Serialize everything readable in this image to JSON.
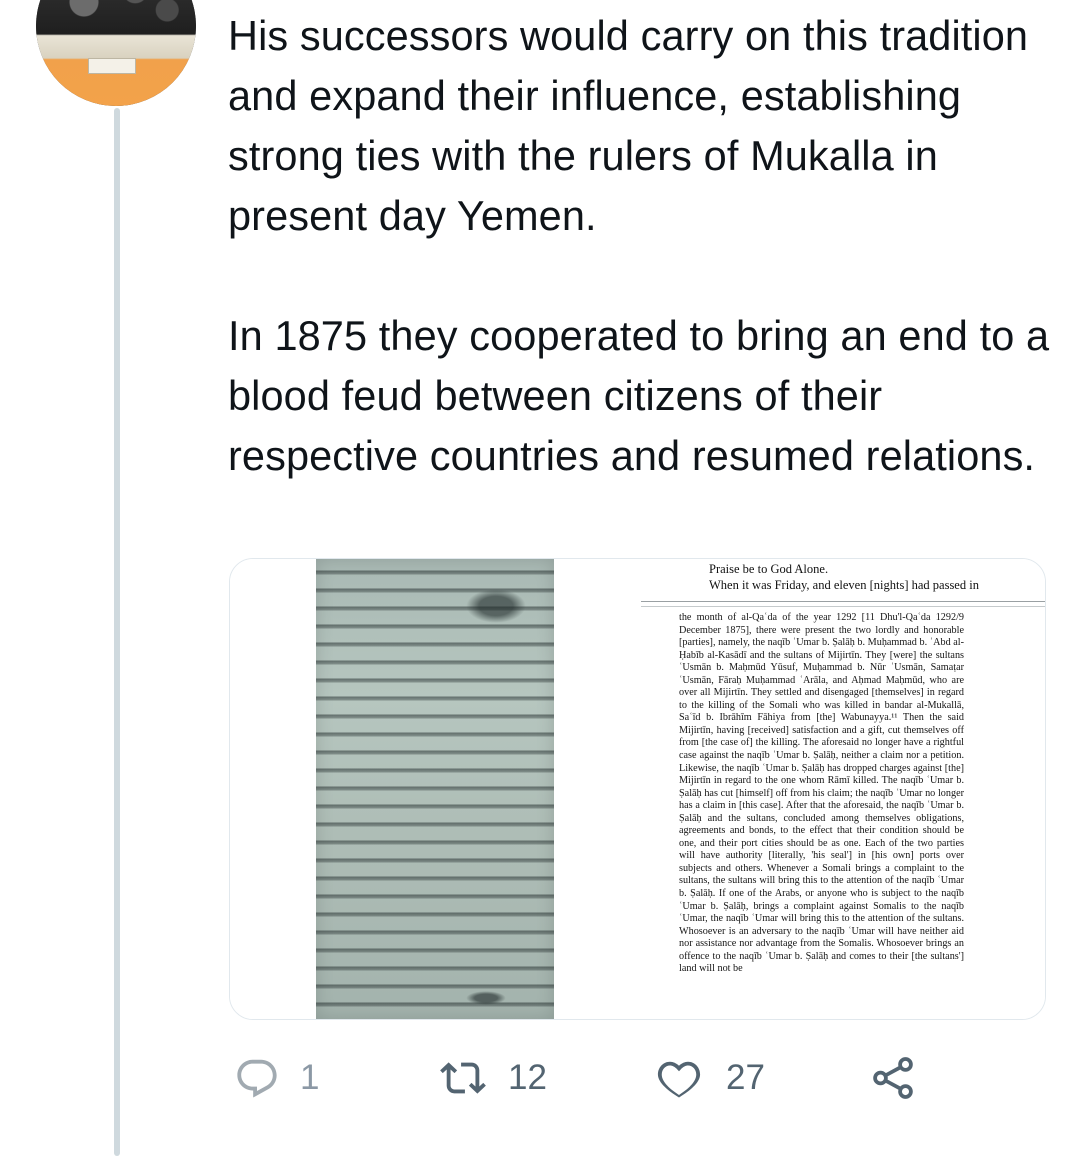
{
  "tweet": {
    "paragraphs": [
      "His successors would carry on this tradition and expand their influence, establishing strong ties with the rulers of Mukalla in present day Yemen.",
      "In 1875 they cooperated to bring an end to a blood feud between citizens of their respective countries and resumed relations."
    ]
  },
  "document": {
    "heading_line1": "Praise be to God Alone.",
    "heading_line2": "When it was Friday, and eleven [nights] had passed in",
    "body": "the month of al-Qaʿda of the year 1292 [11 Dhu'l-Qaʿda 1292/9 December 1875], there were present the two lordly and honorable [parties], namely, the naqīb ʿUmar b. Ṣalāḥ b. Muḥammad b. ʿAbd al-Ḥabīb al-Kasādī and the sultans of Mijirtīn. They [were] the sultans ʿUsmān b. Maḥmūd Yūsuf, Muḥammad b. Nūr ʿUsmān, Samaṭar ʿUsmān, Fāraḥ Muḥammad ʿArāla, and Aḥmad Maḥmūd, who are over all Mijirtīn. They settled and disengaged [themselves] in regard to the killing of the Somali who was killed in bandar al-Mukallā, Saʿīd b. Ibrāhīm Fāhiya from [the] Wabunayya.¹¹ Then the said Mijirtīn, having [received] satisfaction and a gift, cut themselves off from [the case of] the killing. The aforesaid no longer have a rightful case against the naqīb ʿUmar b. Ṣalāḥ, neither a claim nor a petition. Likewise, the naqīb ʿUmar b. Ṣalāḥ has dropped charges against [the] Mijirtīn in regard to the one whom Rāmī killed. The naqīb ʿUmar b. Ṣalāḥ has cut [himself] off from his claim; the naqīb ʿUmar no longer has a claim in [this case]. After that the aforesaid, the naqīb ʿUmar b. Ṣalāḥ and the sultans, concluded among themselves obligations, agreements and bonds, to the effect that their condition should be one, and their port cities should be as one. Each of the two parties will have authority [literally, 'his seal'] in [his own] ports over subjects and others. Whenever a Somali brings a complaint to the sultans, the sultans will bring this to the attention of the naqīb ʿUmar b. Ṣalāḥ. If one of the Arabs, or anyone who is subject to the naqīb ʿUmar b. Ṣalāḥ, brings a complaint against Somalis to the naqīb ʿUmar, the naqīb ʿUmar will bring this to the attention of the sultans. Whosoever is an adversary to the naqīb ʿUmar will have neither aid nor assistance nor advantage from the Somalis. Whosoever brings an offence to the naqīb ʿUmar b. Ṣalāḥ and comes to their [the sultans'] land will not be"
  },
  "actions": {
    "reply_count": "1",
    "retweet_count": "12",
    "like_count": "27"
  },
  "icons": {
    "reply": "reply-icon",
    "retweet": "retweet-icon",
    "like": "heart-icon",
    "share": "share-icon"
  },
  "colors": {
    "text": "#0f1419",
    "action": "#536471",
    "thread_line": "#cfd9de"
  }
}
